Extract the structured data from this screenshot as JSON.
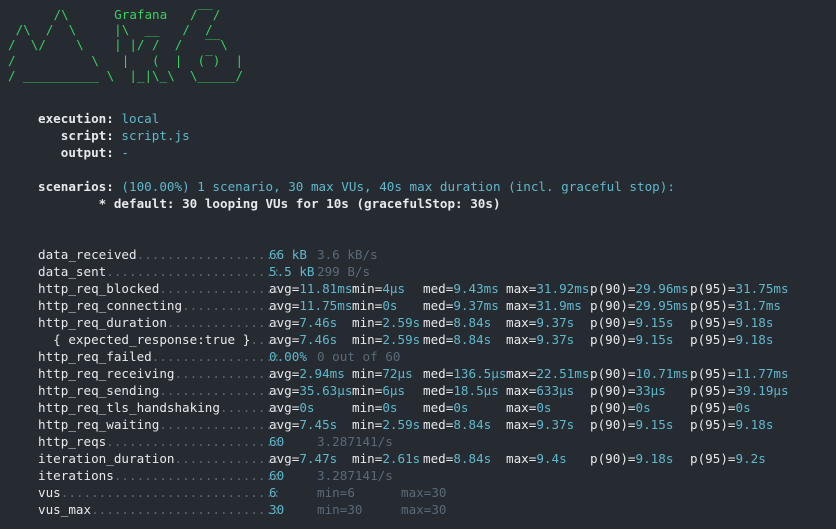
{
  "logo": {
    "art": "      /\\      Grafana   /‾‾/\n /\\  /  \\     |\\  __   /  /\n/  \\/    \\    | |/ /  /   ‾‾\\\n/          \\   |   (  |  (‾)  |\n/ __________ \\  |_|\\_\\  \\_____/"
  },
  "config": {
    "execution_key": "execution:",
    "execution_val": "local",
    "script_key": "script:",
    "script_val": "script.js",
    "output_key": "output:",
    "output_val": "-"
  },
  "scenarios": {
    "key": "scenarios:",
    "summary": "(100.00%) 1 scenario, 30 max VUs, 40s max duration (incl. graceful stop):",
    "default": "* default: 30 looping VUs for 10s (gracefulStop: 30s)"
  },
  "metrics": [
    {
      "name": "data_received",
      "dots": "..................:",
      "value": "66 kB",
      "rate": "3.6 kB/s"
    },
    {
      "name": "data_sent",
      "dots": "......................:",
      "value": "5.5 kB",
      "rate": "299 B/s"
    },
    {
      "name": "http_req_blocked",
      "dots": "...............:",
      "stats": {
        "avg": "11.81ms",
        "min": "4µs",
        "med": "9.43ms",
        "max": "31.92ms",
        "p90": "29.96ms",
        "p95": "31.75ms"
      }
    },
    {
      "name": "http_req_connecting",
      "dots": "............:",
      "stats": {
        "avg": "11.75ms",
        "min": "0s",
        "med": "9.37ms",
        "max": "31.9ms",
        "p90": "29.95ms",
        "p95": "31.7ms"
      }
    },
    {
      "name": "http_req_duration",
      "dots": "..............:",
      "stats": {
        "avg": "7.46s",
        "min": "2.59s",
        "med": "8.84s",
        "max": "9.37s",
        "p90": "9.15s",
        "p95": "9.18s"
      }
    },
    {
      "name": "  { expected_response:true }",
      "dots": "...:",
      "stats": {
        "avg": "7.46s",
        "min": "2.59s",
        "med": "8.84s",
        "max": "9.37s",
        "p90": "9.15s",
        "p95": "9.18s"
      }
    },
    {
      "name": "http_req_failed",
      "dots": "................:",
      "value": "0.00%",
      "rate": "0 out of 60"
    },
    {
      "name": "http_req_receiving",
      "dots": ".............:",
      "stats": {
        "avg": "2.94ms",
        "min": "72µs",
        "med": "136.5µs",
        "max": "22.51ms",
        "p90": "10.71ms",
        "p95": "11.77ms"
      }
    },
    {
      "name": "http_req_sending",
      "dots": "...............:",
      "stats": {
        "avg": "35.63µs",
        "min": "6µs",
        "med": "18.5µs",
        "max": "633µs",
        "p90": "33µs",
        "p95": "39.19µs"
      }
    },
    {
      "name": "http_req_tls_handshaking",
      "dots": ".......:",
      "stats": {
        "avg": "0s",
        "min": "0s",
        "med": "0s",
        "max": "0s",
        "p90": "0s",
        "p95": "0s"
      }
    },
    {
      "name": "http_req_waiting",
      "dots": "...............:",
      "stats": {
        "avg": "7.45s",
        "min": "2.59s",
        "med": "8.84s",
        "max": "9.37s",
        "p90": "9.15s",
        "p95": "9.18s"
      }
    },
    {
      "name": "http_reqs",
      "dots": "......................:",
      "value": "60",
      "rate": "3.287141/s"
    },
    {
      "name": "iteration_duration",
      "dots": ".............:",
      "stats": {
        "avg": "7.47s",
        "min": "2.61s",
        "med": "8.84s",
        "max": "9.4s",
        "p90": "9.18s",
        "p95": "9.2s"
      }
    },
    {
      "name": "iterations",
      "dots": ".....................:",
      "value": "60",
      "rate": "3.287141/s"
    },
    {
      "name": "vus",
      "dots": "............................:",
      "value": "6",
      "min": "min=6",
      "max": "max=30"
    },
    {
      "name": "vus_max",
      "dots": "........................:",
      "value": "30",
      "min": "min=30",
      "max": "max=30"
    }
  ]
}
